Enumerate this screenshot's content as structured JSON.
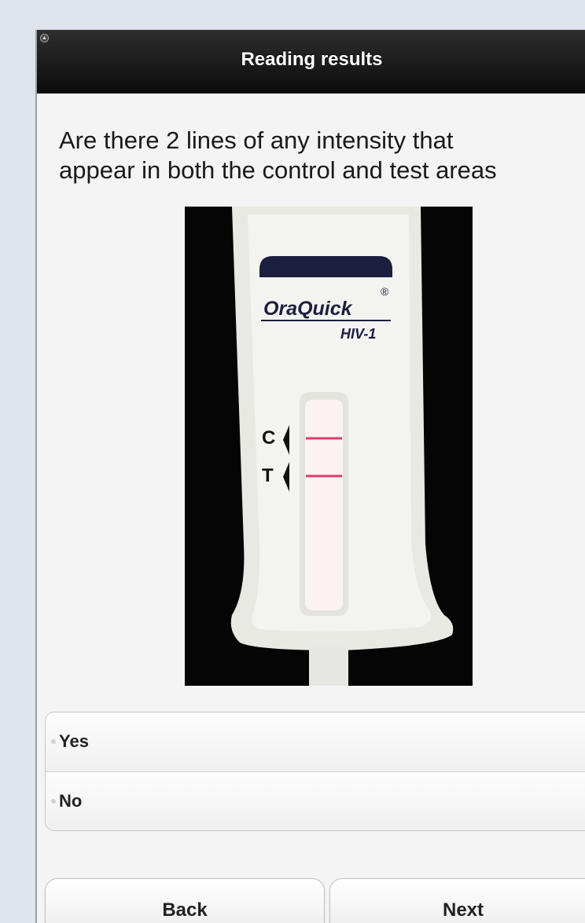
{
  "header": {
    "title": "Reading results",
    "corner_icon": "circle-up-icon"
  },
  "question": {
    "line1": "Are there 2 lines of any intensity that",
    "line2": "appear in both the control and test areas"
  },
  "test_image": {
    "brand": "OraQuick",
    "registered": "®",
    "product": "HIV-1",
    "control_marker": "C",
    "test_marker": "T",
    "control_line_color": "#e33a6f",
    "test_line_color": "#e33a6f"
  },
  "choices": [
    {
      "label": "Yes"
    },
    {
      "label": "No"
    }
  ],
  "buttons": {
    "back": "Back",
    "next": "Next"
  }
}
